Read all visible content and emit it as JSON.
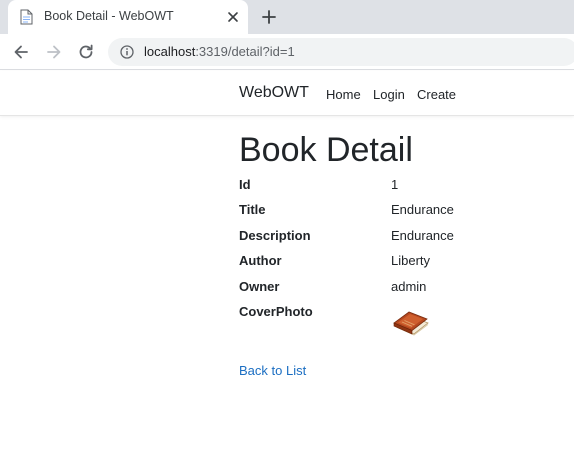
{
  "browser": {
    "tab_title": "Book Detail - WebOWT",
    "url_host": "localhost",
    "url_path": ":3319/detail?id=1"
  },
  "navbar": {
    "brand": "WebOWT",
    "links": [
      "Home",
      "Login",
      "Create"
    ]
  },
  "page": {
    "title": "Book Detail",
    "fields": [
      {
        "label": "Id",
        "value": "1"
      },
      {
        "label": "Title",
        "value": "Endurance"
      },
      {
        "label": "Description",
        "value": "Endurance"
      },
      {
        "label": "Author",
        "value": "Liberty"
      },
      {
        "label": "Owner",
        "value": "admin"
      },
      {
        "label": "CoverPhoto",
        "value": ""
      }
    ],
    "cover_icon": "book-icon",
    "back_link": "Back to List"
  },
  "colors": {
    "link": "#1b6ec2",
    "tabstrip": "#dee1e6",
    "omnibox": "#f1f3f4"
  }
}
